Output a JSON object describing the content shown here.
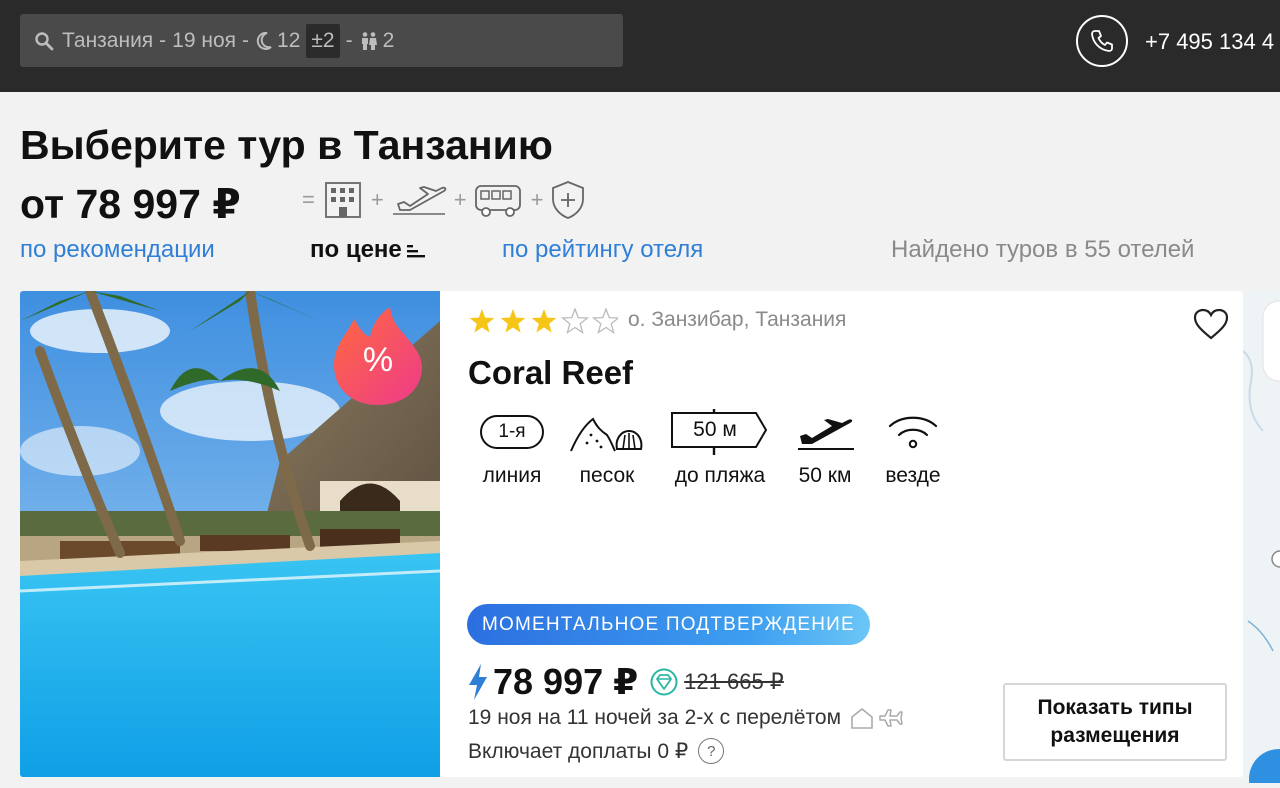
{
  "search": {
    "destination": "Танзания",
    "dash1": "-",
    "date": "19 ноя",
    "dash2": "-",
    "nights": "12",
    "flex": "±2",
    "dash3": "-",
    "guests": "2"
  },
  "header": {
    "phone": "+7 495 134 4"
  },
  "title": {
    "main": "Выберите тур в Танзанию",
    "price_from": "от 78 997 ₽",
    "pkg_eq": "=",
    "pkg_plus": "+"
  },
  "sort": {
    "by_recommendation": "по рекомендации",
    "by_price": "по цене",
    "by_rating": "по рейтингу отеля",
    "found": "Найдено туров в 55 отелей"
  },
  "hotel": {
    "stars": 3,
    "max_stars": 5,
    "location": "о. Занзибар, Танзания",
    "name": "Coral Reef",
    "discount_symbol": "%",
    "features": [
      {
        "icon": "line-icon",
        "value": "1-я",
        "label": "линия"
      },
      {
        "icon": "sand-icon",
        "label": "песок"
      },
      {
        "icon": "beach-sign-icon",
        "value": "50 м",
        "label": "до пляжа"
      },
      {
        "icon": "airplane-icon",
        "label": "50 км"
      },
      {
        "icon": "wifi-icon",
        "label": "везде"
      }
    ],
    "confirm_badge": "МОМЕНТАЛЬНОЕ ПОДТВЕРЖДЕНИЕ",
    "price": "78 997 ₽",
    "old_price": "121 665 ₽",
    "dates": "19 ноя на 11 ночей за 2-х с перелётом",
    "extra": "Включает доплаты 0 ₽",
    "help": "?",
    "button": "Показать типы размещения"
  },
  "colors": {
    "topbar": "#2a2a2a",
    "link": "#2f7fd6",
    "star": "#f5c518",
    "badge_start": "#2c6fe0",
    "badge_end": "#6cc6f6",
    "lightning": "#2f7fd6",
    "gem": "#2bb8a3",
    "discount_start": "#ff6a3d",
    "discount_end": "#ee3b8b"
  }
}
